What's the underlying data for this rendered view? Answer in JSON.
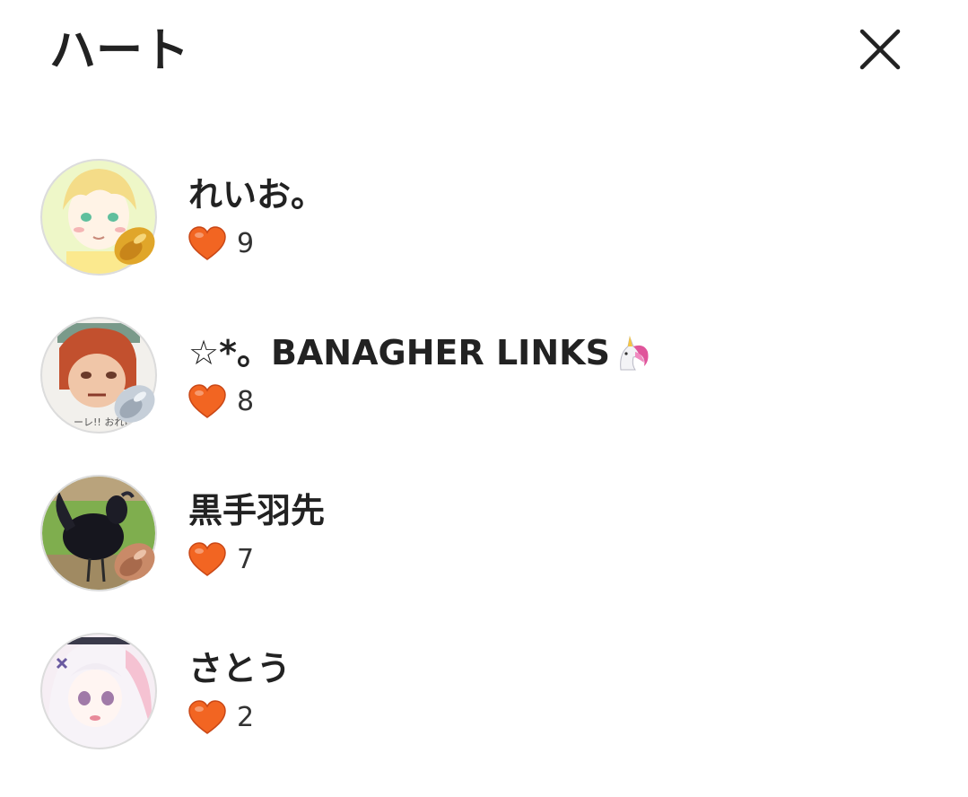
{
  "header": {
    "title": "ハート",
    "close_icon": "close-icon"
  },
  "users": [
    {
      "name": "れいお。",
      "hearts": "9",
      "badge": "gold"
    },
    {
      "name": "☆*。BANAGHER LINKS",
      "name_emoji": "unicorn-icon",
      "hearts": "8",
      "badge": "silver"
    },
    {
      "name": "黒手羽先",
      "hearts": "7",
      "badge": "bronze"
    },
    {
      "name": "さとう",
      "hearts": "2",
      "badge": "none"
    }
  ],
  "colors": {
    "heart": "#f26522",
    "heart_outline": "#c94716",
    "text": "#222222",
    "gold_badge": "#e0a62a",
    "silver_badge": "#c6cfd9",
    "bronze_badge": "#c98a68"
  }
}
